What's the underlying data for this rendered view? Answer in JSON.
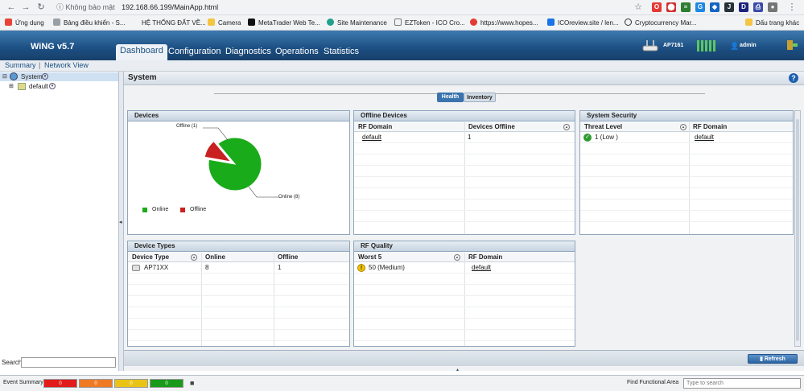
{
  "browser": {
    "security": "Không bảo mật",
    "url": "192.168.66.199/MainApp.html"
  },
  "bookmarks": [
    {
      "label": "Ứng dụng",
      "color": "#ea4335"
    },
    {
      "label": "Bảng điều khiển - S...",
      "color": "#9aa0a6"
    },
    {
      "label": "HỆ THỐNG ĐẤT VỀ...",
      "color": "#ffffff"
    },
    {
      "label": "Camera",
      "color": "#f4c542"
    },
    {
      "label": "MetaTrader Web Te...",
      "color": "#111111"
    },
    {
      "label": "Site Maintenance",
      "color": "#21a08b"
    },
    {
      "label": "EZToken - ICO Cro...",
      "color": "#ffffff"
    },
    {
      "label": "https://www.hopes...",
      "color": "#e53935"
    },
    {
      "label": "ICOreview.site / len...",
      "color": "#1a73e8"
    },
    {
      "label": "Cryptocurrency Mar...",
      "color": "#333333"
    },
    {
      "label": "Dấu trang khác",
      "color": "#f4c542"
    }
  ],
  "app": {
    "logo": "WiNG v5.7",
    "device": "AP7161",
    "user": "admin"
  },
  "menu": [
    "Dashboard",
    "Configuration",
    "Diagnostics",
    "Operations",
    "Statistics"
  ],
  "subnav": [
    "Summary",
    "Network View"
  ],
  "tree": {
    "root": "System",
    "child": "default"
  },
  "search_label": "Search",
  "content_title": "System",
  "tabs": [
    "Health",
    "Inventory"
  ],
  "devices": {
    "title": "Devices",
    "offline_label": "Offline (1)",
    "online_label": "Online (8)",
    "legend": [
      "Online",
      "Offline"
    ],
    "colors": {
      "online": "#1aab1a",
      "offline": "#c92020"
    }
  },
  "chart_data": {
    "type": "pie",
    "labels": [
      "Online",
      "Offline"
    ],
    "values": [
      8,
      1
    ],
    "annotations": [
      "Offline (1)",
      "Online (8)"
    ],
    "legend": "bottom-left"
  },
  "offline_devices": {
    "title": "Offline Devices",
    "cols": [
      "RF Domain",
      "Devices Offline"
    ],
    "rows": [
      [
        "default",
        "1"
      ]
    ]
  },
  "system_security": {
    "title": "System Security",
    "cols": [
      "Threat Level",
      "RF Domain"
    ],
    "rows": [
      [
        "1 (Low )",
        "default"
      ]
    ]
  },
  "device_types": {
    "title": "Device Types",
    "cols": [
      "Device Type",
      "Online",
      "Offline"
    ],
    "rows": [
      [
        "AP71XX",
        "8",
        "1"
      ]
    ]
  },
  "rf_quality": {
    "title": "RF Quality",
    "cols": [
      "Worst 5",
      "RF Domain"
    ],
    "rows": [
      [
        "50 (Medium)",
        "default"
      ]
    ]
  },
  "refresh": "Refresh",
  "footer": {
    "event_summary": "Event Summary",
    "counts": [
      "0",
      "0",
      "0",
      "0"
    ],
    "colors": [
      "#e21b1b",
      "#f07a22",
      "#e9c417",
      "#1a9a1a"
    ],
    "find_label": "Find Functional Area",
    "find_placeholder": "Type to search"
  }
}
